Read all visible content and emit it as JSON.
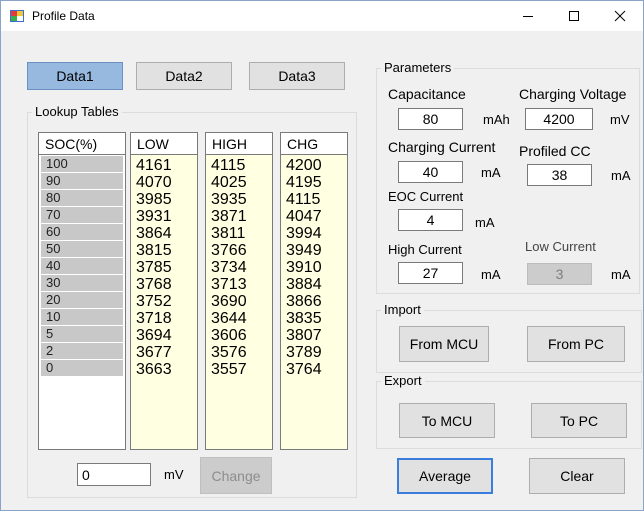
{
  "window": {
    "title": "Profile Data",
    "controls": {
      "minimize": "—",
      "maximize": "☐",
      "close": "✕"
    }
  },
  "tabs": [
    {
      "label": "Data1",
      "active": true
    },
    {
      "label": "Data2",
      "active": false
    },
    {
      "label": "Data3",
      "active": false
    }
  ],
  "lookup": {
    "group_label": "Lookup Tables",
    "columns": {
      "soc": {
        "header": "SOC(%)",
        "values": [
          "100",
          "90",
          "80",
          "70",
          "60",
          "50",
          "40",
          "30",
          "20",
          "10",
          "5",
          "2",
          "0"
        ]
      },
      "low": {
        "header": "LOW",
        "values": [
          "4161",
          "4070",
          "3985",
          "3931",
          "3864",
          "3815",
          "3785",
          "3768",
          "3752",
          "3718",
          "3694",
          "3677",
          "3663"
        ]
      },
      "high": {
        "header": "HIGH",
        "values": [
          "4115",
          "4025",
          "3935",
          "3871",
          "3811",
          "3766",
          "3734",
          "3713",
          "3690",
          "3644",
          "3606",
          "3576",
          "3557"
        ]
      },
      "chg": {
        "header": "CHG",
        "values": [
          "4200",
          "4195",
          "4115",
          "4047",
          "3994",
          "3949",
          "3910",
          "3884",
          "3866",
          "3835",
          "3807",
          "3789",
          "3764"
        ]
      }
    },
    "input_value": "0",
    "input_unit": "mV",
    "change_label": "Change"
  },
  "parameters": {
    "group_label": "Parameters",
    "capacitance": {
      "label": "Capacitance",
      "value": "80",
      "unit": "mAh"
    },
    "charging_voltage": {
      "label": "Charging Voltage",
      "value": "4200",
      "unit": "mV"
    },
    "charging_current": {
      "label": "Charging Current",
      "value": "40",
      "unit": "mA"
    },
    "profiled_cc": {
      "label": "Profiled CC",
      "value": "38",
      "unit": "mA"
    },
    "eoc_current": {
      "label": "EOC Current",
      "value": "4",
      "unit": "mA"
    },
    "high_current": {
      "label": "High Current",
      "value": "27",
      "unit": "mA"
    },
    "low_current": {
      "label": "Low Current",
      "value": "3",
      "unit": "mA"
    }
  },
  "import": {
    "group_label": "Import",
    "from_mcu": "From MCU",
    "from_pc": "From PC"
  },
  "export": {
    "group_label": "Export",
    "to_mcu": "To MCU",
    "to_pc": "To PC"
  },
  "footer": {
    "average": "Average",
    "clear": "Clear"
  },
  "colors": {
    "accent": "#97b9e0",
    "table_bg": "#ffffe1",
    "focus": "#3b7ddd"
  }
}
